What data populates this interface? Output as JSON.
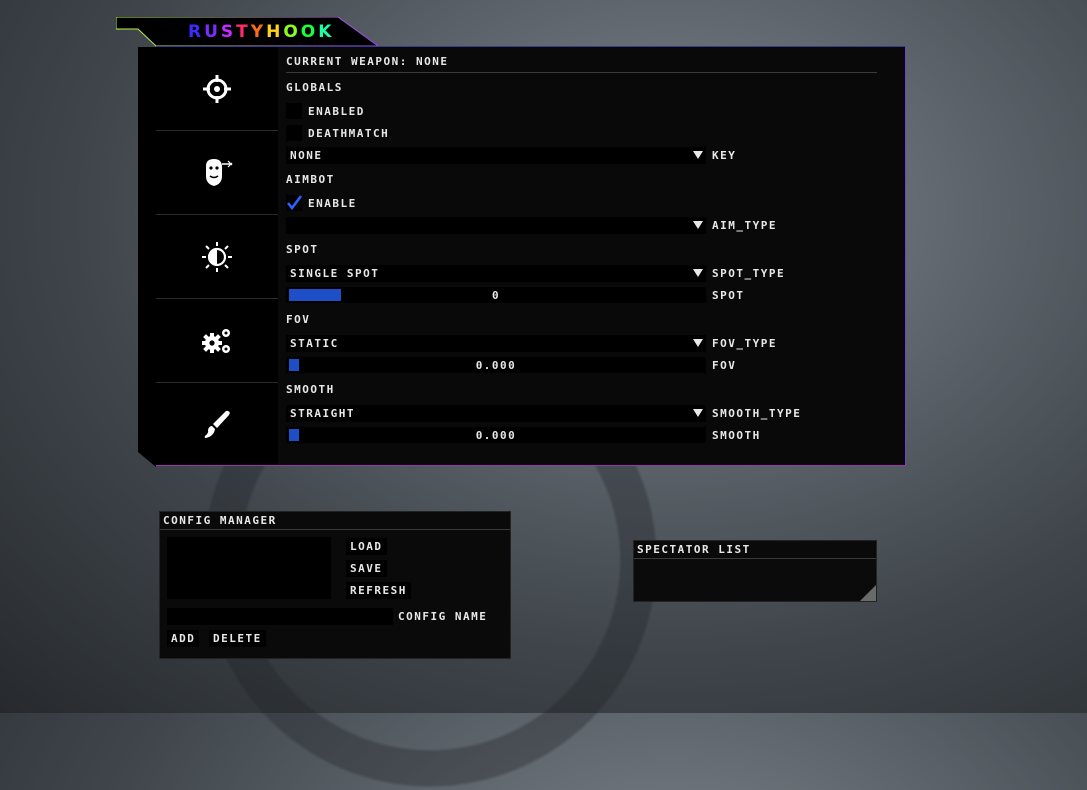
{
  "brand": {
    "letters": [
      "R",
      "U",
      "S",
      "T",
      "Y",
      "H",
      "O",
      "O",
      "K"
    ],
    "colors": [
      "#3a2cff",
      "#7a2cff",
      "#c22cff",
      "#ff2c6a",
      "#ff6a1a",
      "#ffd21a",
      "#8aff1a",
      "#1aff3a",
      "#1affa0"
    ]
  },
  "sidebar": {
    "icons": [
      "crosshair-icon",
      "head-target-icon",
      "brightness-icon",
      "gears-icon",
      "paintbrush-icon"
    ]
  },
  "header": {
    "current_weapon": "Current weapon: none"
  },
  "globals": {
    "section": "Globals",
    "enabled_label": "Enabled",
    "deathmatch_label": "Deathmatch",
    "key_value": "None",
    "key_label": "Key"
  },
  "aimbot": {
    "section": "Aimbot",
    "enable_label": "Enable",
    "enable_checked": true,
    "aim_type_value": "",
    "aim_type_label": "aim_type"
  },
  "spot": {
    "section": "Spot",
    "type_value": "Single spot",
    "type_label": "spot_type",
    "slider_value": "0",
    "slider_label": "Spot"
  },
  "fov": {
    "section": "Fov",
    "type_value": "Static",
    "type_label": "fov_type",
    "slider_value": "0.000",
    "slider_label": "Fov"
  },
  "smooth": {
    "section": "Smooth",
    "type_value": "Straight",
    "type_label": "smooth_type",
    "slider_value": "0.000",
    "slider_label": "Smooth"
  },
  "config_manager": {
    "title": "Config manager",
    "load": "Load",
    "save": "Save",
    "refresh": "Refresh",
    "config_name_label": "Config name",
    "add": "Add",
    "delete": "Delete"
  },
  "spectator": {
    "title": "Spectator list"
  },
  "accent": "#1d4fc7"
}
